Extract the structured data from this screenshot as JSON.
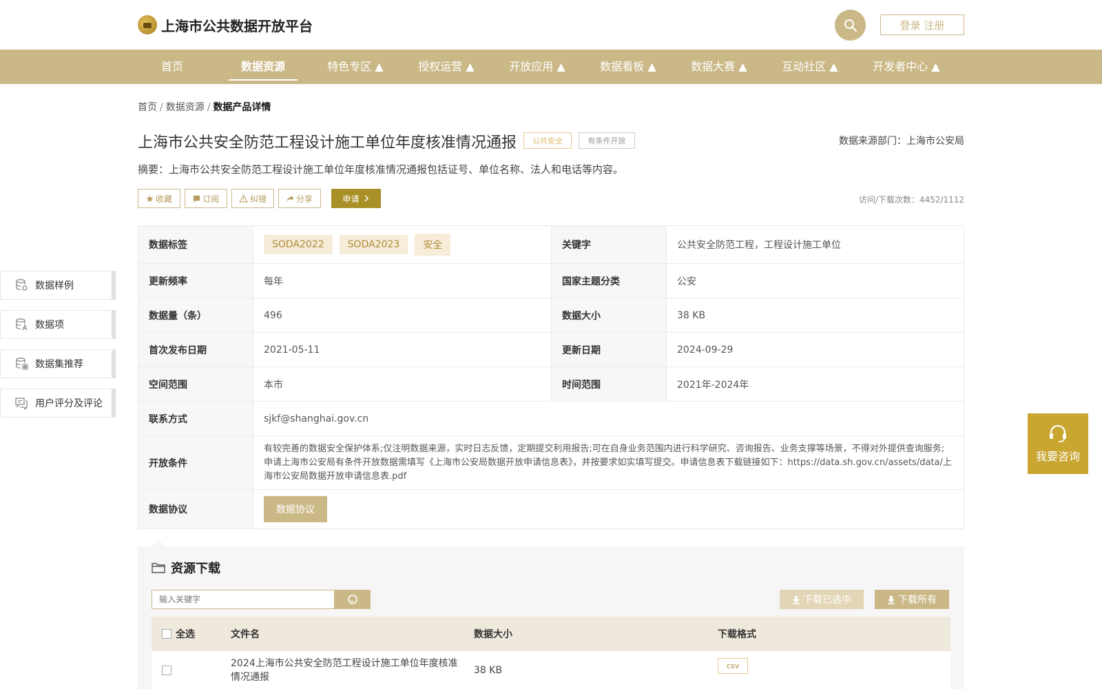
{
  "header": {
    "site_title": "上海市公共数据开放平台",
    "login_label": "登录 注册"
  },
  "nav": {
    "items": [
      "首页",
      "数据资源",
      "特色专区 ▲",
      "授权运营 ▲",
      "开放应用 ▲",
      "数据看板 ▲",
      "数据大赛 ▲",
      "互动社区 ▲",
      "开发者中心 ▲"
    ],
    "active_index": 1
  },
  "breadcrumb": {
    "home": "首页",
    "section": "数据资源",
    "current": "数据产品详情"
  },
  "dataset": {
    "title": "上海市公共安全防范工程设计施工单位年度核准情况通报",
    "tag_category": "公共安全",
    "tag_open": "有条件开放",
    "source_dept": "数据来源部门：上海市公安局",
    "summary": "摘要：上海市公共安全防范工程设计施工单位年度核准情况通报包括证号、单位名称、法人和电话等内容。",
    "visits": "访问/下载次数：4452/1112"
  },
  "actions": {
    "favorite": "收藏",
    "subscribe": "订阅",
    "report": "纠错",
    "share": "分享",
    "apply": "申请"
  },
  "info": {
    "tags_label": "数据标签",
    "tags": [
      "SODA2022",
      "SODA2023",
      "安全"
    ],
    "keywords_label": "关键字",
    "keywords": "公共安全防范工程，工程设计施工单位",
    "freq_label": "更新频率",
    "freq": "每年",
    "theme_label": "国家主题分类",
    "theme": "公安",
    "count_label": "数据量（条）",
    "count": "496",
    "size_label": "数据大小",
    "size": "38 KB",
    "first_pub_label": "首次发布日期",
    "first_pub": "2021-05-11",
    "update_label": "更新日期",
    "update": "2024-09-29",
    "space_label": "空间范围",
    "space": "本市",
    "time_label": "时间范围",
    "time": "2021年-2024年",
    "contact_label": "联系方式",
    "contact": "sjkf@shanghai.gov.cn",
    "condition_label": "开放条件",
    "condition": "有较完善的数据安全保护体系;仅注明数据来源，实时日志反馈，定期提交利用报告;可在自身业务范围内进行科学研究、咨询报告、业务支撑等场景，不得对外提供查询服务;申请上海市公安局有条件开放数据需填写《上海市公安局数据开放申请信息表》，并按要求如实填写提交。申请信息表下载链接如下：https://data.sh.gov.cn/assets/data/上海市公安局数据开放申请信息表.pdf",
    "agreement_label": "数据协议",
    "agreement_button": "数据协议"
  },
  "side_menu": {
    "items": [
      "数据样例",
      "数据项",
      "数据集推荐",
      "用户评分及评论"
    ]
  },
  "consult": {
    "label": "我要咨询"
  },
  "resources": {
    "title": "资源下载",
    "search_placeholder": "输入关键字",
    "download_selected": "下载已选中",
    "download_all": "下载所有",
    "columns": {
      "select_all": "全选",
      "filename": "文件名",
      "size": "数据大小",
      "format": "下载格式"
    },
    "rows": [
      {
        "filename": "2024上海市公共安全防范工程设计施工单位年度核准情况通报",
        "size": "38 KB",
        "format": "csv"
      }
    ]
  },
  "colors": {
    "brand_gold": "#cbb887",
    "apply_olive": "#a99026",
    "consult_gold": "#c9a630"
  }
}
